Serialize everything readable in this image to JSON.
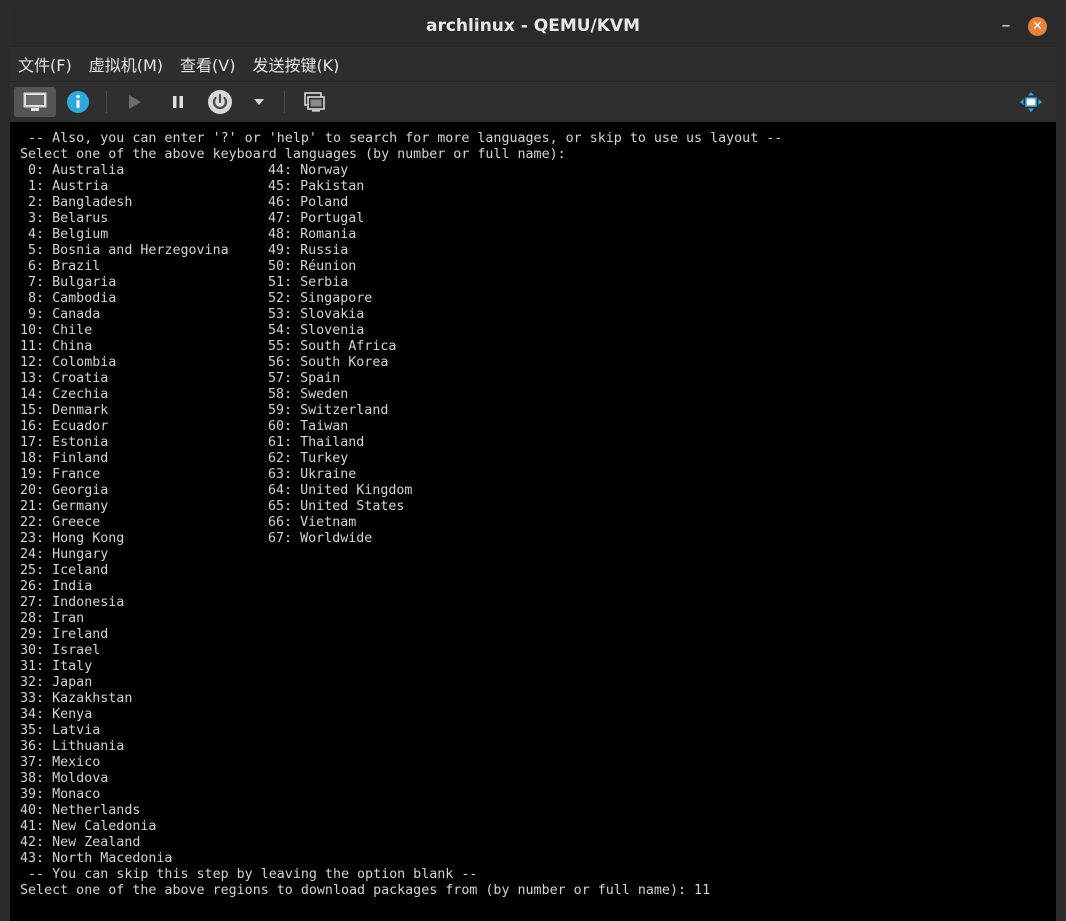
{
  "window": {
    "title": "archlinux - QEMU/KVM",
    "minimize_glyph": "–",
    "close_glyph": "✕"
  },
  "menubar": {
    "items": [
      "文件(F)",
      "虚拟机(M)",
      "查看(V)",
      "发送按键(K)"
    ]
  },
  "toolbar": {
    "icons": [
      "monitor-icon",
      "info-icon",
      "play-icon",
      "pause-icon",
      "power-icon",
      "dropdown-icon",
      "screenshot-icon",
      "fullscreen-icon"
    ]
  },
  "terminal": {
    "header_line1": " -- Also, you can enter '?' or 'help' to search for more languages, or skip to use us layout --",
    "header_line2": "Select one of the above keyboard languages (by number or full name):",
    "left_column": [
      " 0: Australia",
      " 1: Austria",
      " 2: Bangladesh",
      " 3: Belarus",
      " 4: Belgium",
      " 5: Bosnia and Herzegovina",
      " 6: Brazil",
      " 7: Bulgaria",
      " 8: Cambodia",
      " 9: Canada",
      "10: Chile",
      "11: China",
      "12: Colombia",
      "13: Croatia",
      "14: Czechia",
      "15: Denmark",
      "16: Ecuador",
      "17: Estonia",
      "18: Finland",
      "19: France",
      "20: Georgia",
      "21: Germany",
      "22: Greece",
      "23: Hong Kong",
      "24: Hungary",
      "25: Iceland",
      "26: India",
      "27: Indonesia",
      "28: Iran",
      "29: Ireland",
      "30: Israel",
      "31: Italy",
      "32: Japan",
      "33: Kazakhstan",
      "34: Kenya",
      "35: Latvia",
      "36: Lithuania",
      "37: Mexico",
      "38: Moldova",
      "39: Monaco",
      "40: Netherlands",
      "41: New Caledonia",
      "42: New Zealand",
      "43: North Macedonia"
    ],
    "right_column": [
      "44: Norway",
      "45: Pakistan",
      "46: Poland",
      "47: Portugal",
      "48: Romania",
      "49: Russia",
      "50: Réunion",
      "51: Serbia",
      "52: Singapore",
      "53: Slovakia",
      "54: Slovenia",
      "55: South Africa",
      "56: South Korea",
      "57: Spain",
      "58: Sweden",
      "59: Switzerland",
      "60: Taiwan",
      "61: Thailand",
      "62: Turkey",
      "63: Ukraine",
      "64: United Kingdom",
      "65: United States",
      "66: Vietnam",
      "67: Worldwide"
    ],
    "footer_line1": " -- You can skip this step by leaving the option blank --",
    "prompt_text": "Select one of the above regions to download packages from (by number or full name): ",
    "prompt_input": "11"
  }
}
